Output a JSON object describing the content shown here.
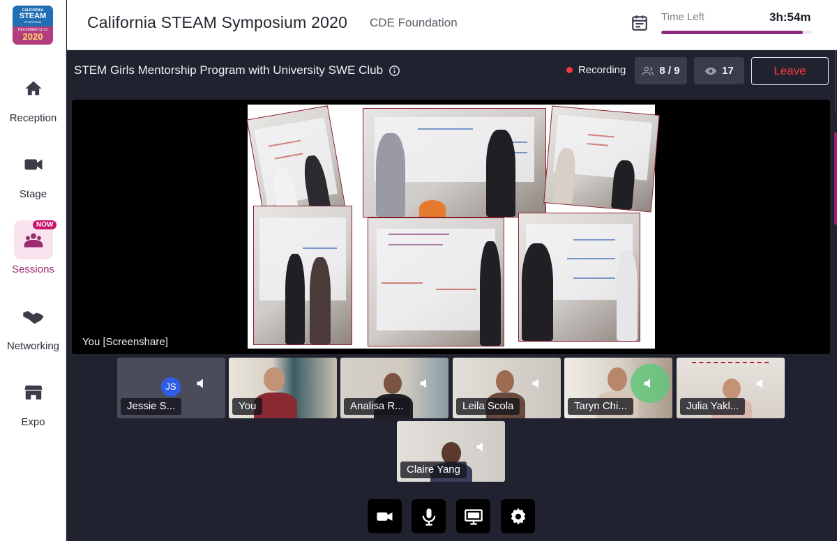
{
  "logo": {
    "line1": "CALIFORNIA",
    "line2": "STEAM",
    "line3": "SYMPOSIUM",
    "line4": "DECEMBER 11-13",
    "line5": "2020"
  },
  "sidebar": {
    "items": [
      {
        "label": "Reception",
        "icon": "home-icon"
      },
      {
        "label": "Stage",
        "icon": "video-camera-icon"
      },
      {
        "label": "Sessions",
        "icon": "sessions-icon",
        "badge": "NOW",
        "active": true
      },
      {
        "label": "Networking",
        "icon": "handshake-icon"
      },
      {
        "label": "Expo",
        "icon": "store-icon"
      }
    ]
  },
  "header": {
    "event_title": "California STEAM Symposium 2020",
    "organizer": "CDE Foundation",
    "time_left_label": "Time Left",
    "time_left_value": "3h:54m",
    "time_progress": 0.94
  },
  "session": {
    "title": "STEM Girls Mentorship Program with University SWE Club",
    "recording_label": "Recording",
    "participants_count": "8 / 9",
    "viewers_count": "17",
    "leave_label": "Leave"
  },
  "stage": {
    "caption": "You [Screenshare]"
  },
  "participants": [
    {
      "name": "Jessie S...",
      "initials": "JS",
      "muted": true
    },
    {
      "name": "You",
      "muted": false
    },
    {
      "name": "Analisa R...",
      "muted": true
    },
    {
      "name": "Leila Scola",
      "muted": true
    },
    {
      "name": "Taryn Chi...",
      "muted": true,
      "speaking": true
    },
    {
      "name": "Julia Yakl...",
      "muted": true
    },
    {
      "name": "Claire Yang",
      "muted": true
    }
  ],
  "controls": [
    "camera-icon",
    "microphone-icon",
    "screen-share-icon",
    "settings-icon"
  ],
  "colors": {
    "accent": "#9a2b6f",
    "leave": "#ee3a3a",
    "recording": "#ef3b3b",
    "stage_bg": "#202230"
  }
}
